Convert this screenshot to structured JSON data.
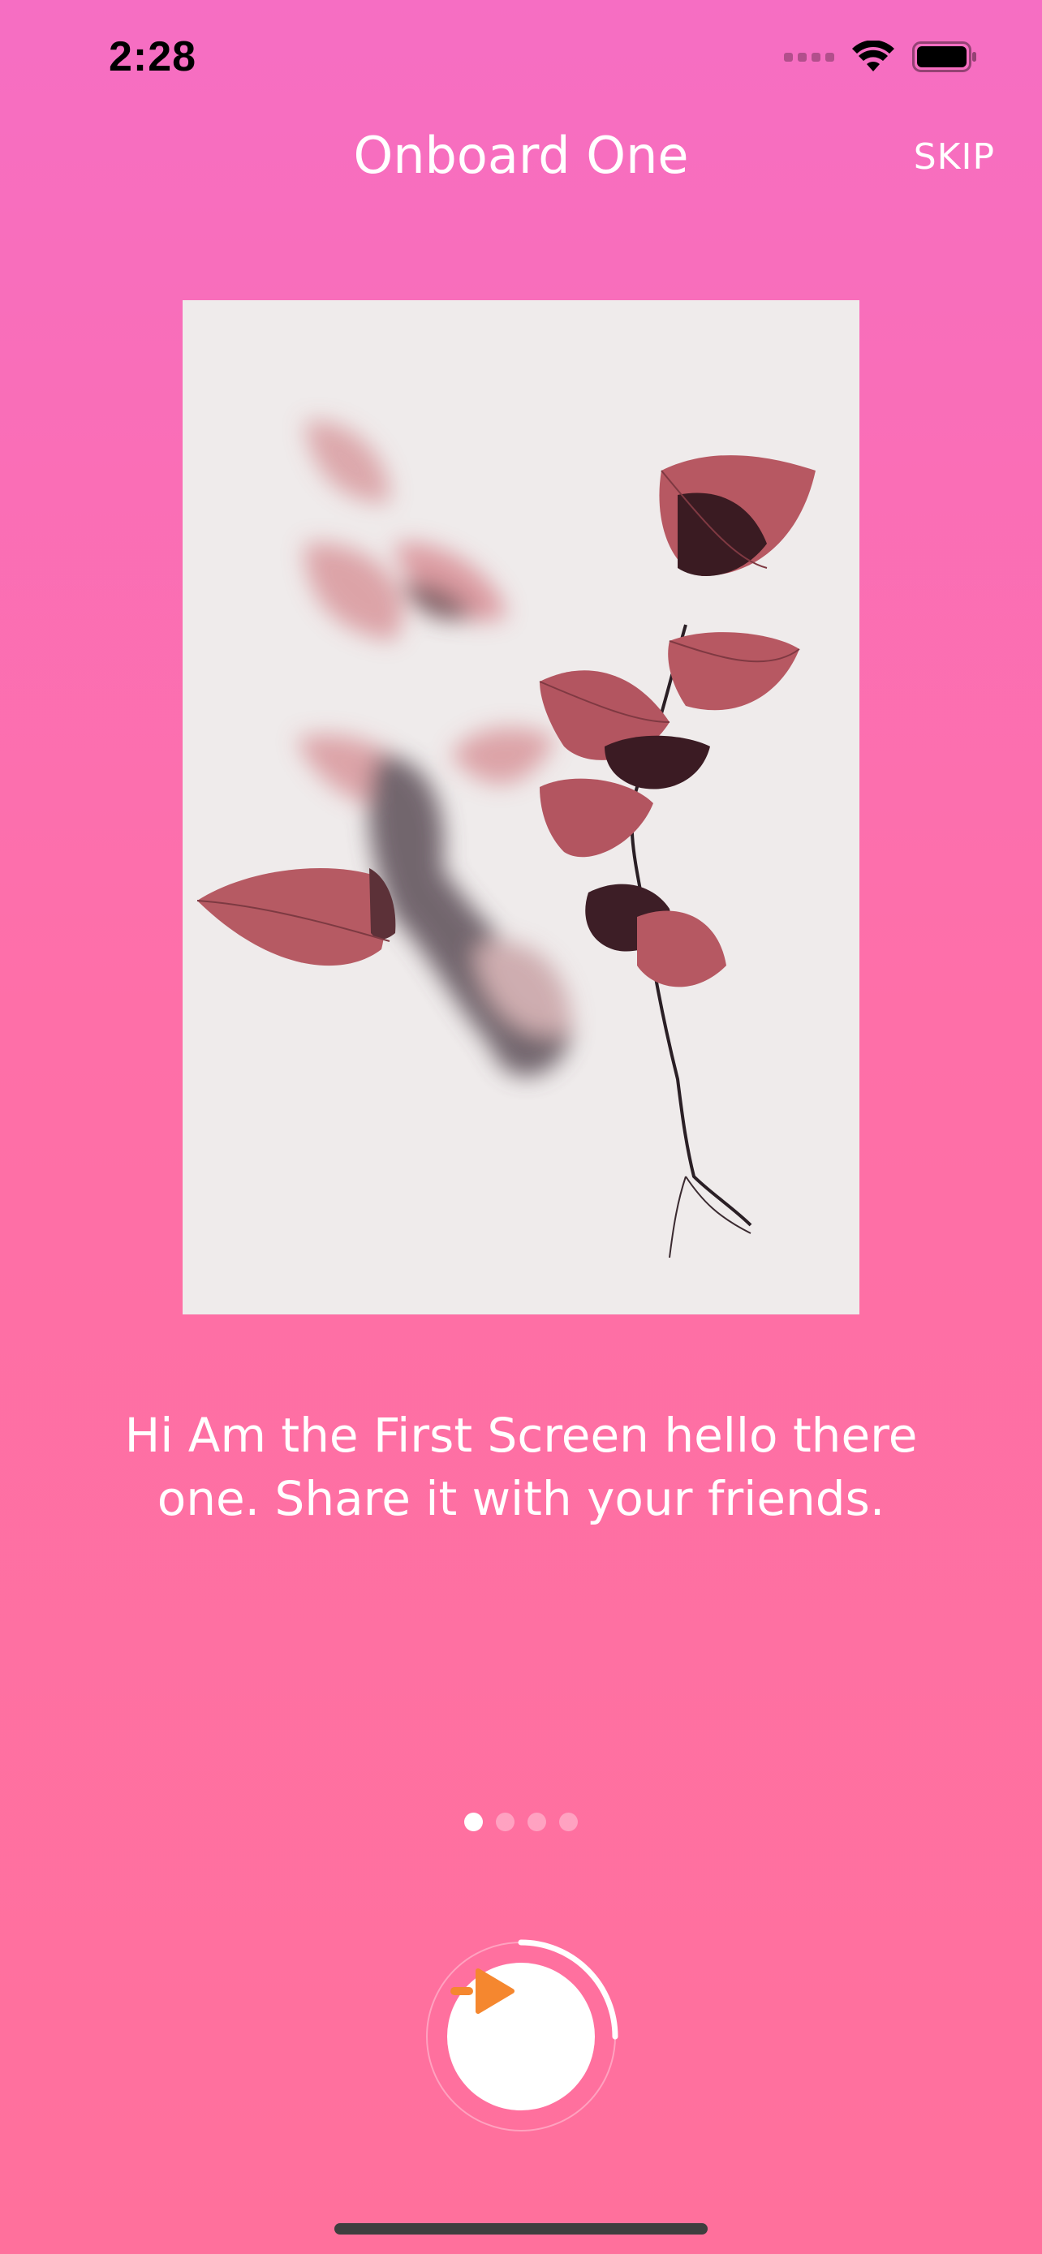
{
  "status_bar": {
    "time": "2:28",
    "wifi_icon": "wifi-icon",
    "battery_icon": "battery-icon",
    "signal_icon": "cellular-signal-icon"
  },
  "nav": {
    "title": "Onboard One",
    "skip_label": "SKIP"
  },
  "illustration": {
    "icon": "leaves-illustration"
  },
  "description": "Hi Am the First Screen hello there one. Share it with your friends.",
  "pagination": {
    "current_page": 1,
    "total_pages": 4
  },
  "next_button": {
    "icon": "arrow-right-icon",
    "progress_fraction": 0.25
  },
  "colors": {
    "background_top": "#f66ec3",
    "background_bottom": "#ff709c",
    "accent_orange": "#f5872f",
    "text": "#ffffff"
  }
}
